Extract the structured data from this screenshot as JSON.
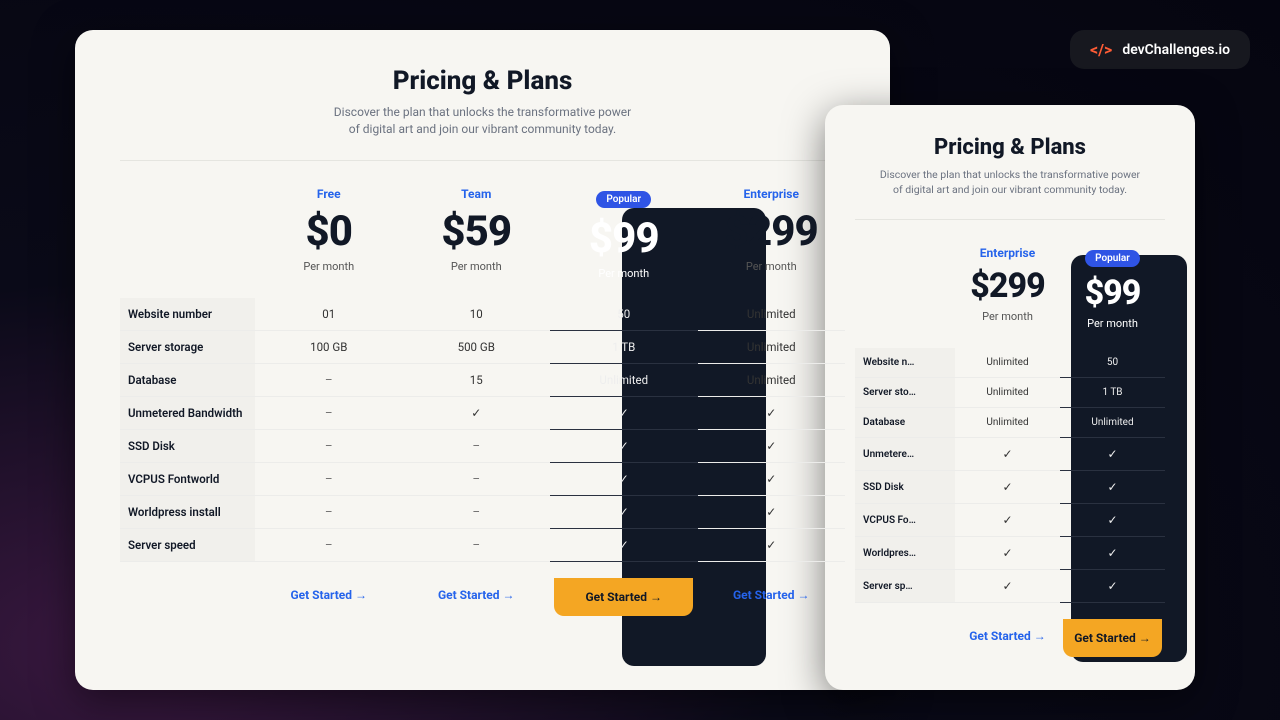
{
  "brand": "devChallenges.io",
  "header": {
    "title": "Pricing & Plans",
    "subtitle1": "Discover the plan that unlocks the transformative power",
    "subtitle2": "of digital art and join our vibrant community today."
  },
  "popular_label": "Popular",
  "per_month": "Per month",
  "cta_label": "Get Started",
  "features": [
    "Website number",
    "Server storage",
    "Database",
    "Unmetered Bandwidth",
    "SSD Disk",
    "VCPUS Fontworld",
    "Worldpress install",
    "Server speed"
  ],
  "plans": [
    {
      "name": "Free",
      "price": "$0",
      "popular": false,
      "values": [
        "01",
        "100 GB",
        "-",
        "-",
        "-",
        "-",
        "-",
        "-"
      ]
    },
    {
      "name": "Team",
      "price": "$59",
      "popular": false,
      "values": [
        "10",
        "500 GB",
        "15",
        "✓",
        "-",
        "-",
        "-",
        "-"
      ]
    },
    {
      "name": "",
      "price": "$99",
      "popular": true,
      "values": [
        "50",
        "1 TB",
        "Unlimited",
        "✓",
        "✓",
        "✓",
        "✓",
        "✓"
      ]
    },
    {
      "name": "Enterprise",
      "price": "$299",
      "popular": false,
      "values": [
        "Unlimited",
        "Unlimited",
        "Unlimited",
        "✓",
        "✓",
        "✓",
        "✓",
        "✓"
      ]
    }
  ],
  "small_plans": [
    {
      "name": "Enterprise",
      "price": "$299",
      "popular": false,
      "values": [
        "Unlimited",
        "Unlimited",
        "Unlimited",
        "✓",
        "✓",
        "✓",
        "✓",
        "✓"
      ]
    },
    {
      "name": "",
      "price": "$99",
      "popular": true,
      "values": [
        "50",
        "1 TB",
        "Unlimited",
        "✓",
        "✓",
        "✓",
        "✓",
        "✓"
      ]
    }
  ],
  "small_feature_labels": [
    "Website n…",
    "Server sto…",
    "Database",
    "Unmetere…",
    "SSD Disk",
    "VCPUS Fo…",
    "Worldpres…",
    "Server sp…"
  ]
}
